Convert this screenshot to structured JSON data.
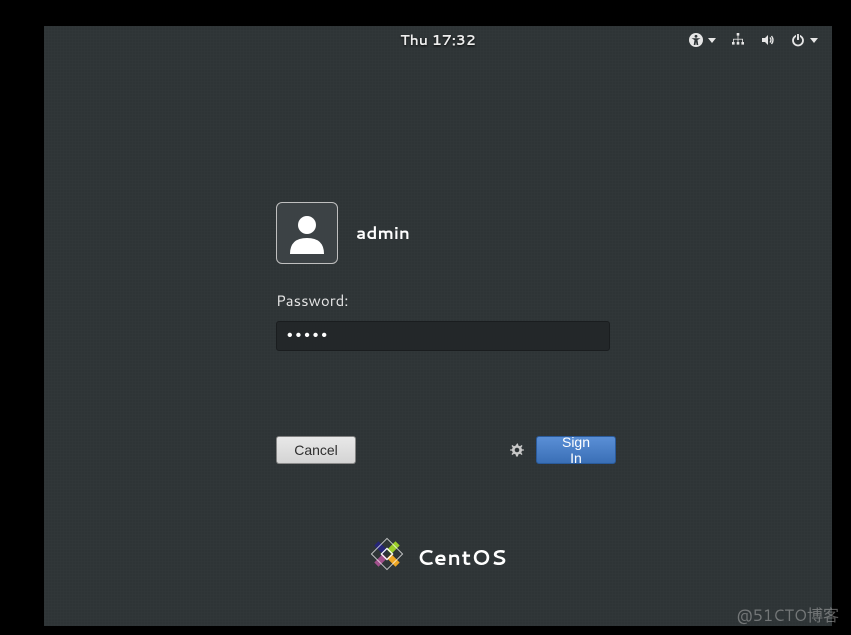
{
  "topbar": {
    "clock": "Thu 17:32"
  },
  "login": {
    "username": "admin",
    "password_label": "Password:",
    "password_value": "•••••",
    "cancel_label": "Cancel",
    "signin_label": "Sign In"
  },
  "branding": {
    "name": "CentOS"
  },
  "watermark": "@51CTO博客",
  "colors": {
    "desktop_bg": "#2e3436",
    "signin_accent": "#4a7fc6",
    "input_bg": "#232729"
  }
}
